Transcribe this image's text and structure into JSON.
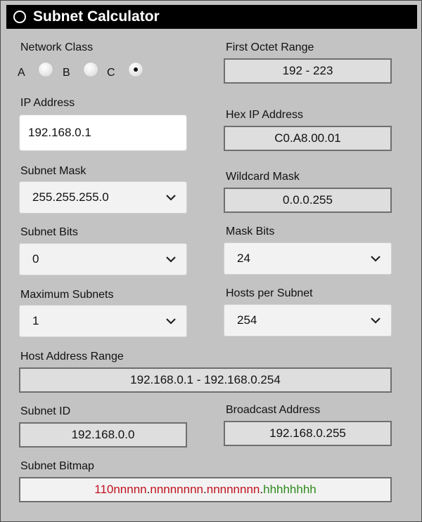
{
  "title": "Subnet Calculator",
  "network_class": {
    "label": "Network Class",
    "options": [
      {
        "letter": "A",
        "selected": false
      },
      {
        "letter": "B",
        "selected": false
      },
      {
        "letter": "C",
        "selected": true
      }
    ]
  },
  "first_octet_range": {
    "label": "First Octet Range",
    "value": "192 - 223"
  },
  "ip_address": {
    "label": "IP Address",
    "value": "192.168.0.1"
  },
  "hex_ip_address": {
    "label": "Hex IP Address",
    "value": "C0.A8.00.01"
  },
  "subnet_mask": {
    "label": "Subnet Mask",
    "value": "255.255.255.0"
  },
  "wildcard_mask": {
    "label": "Wildcard Mask",
    "value": "0.0.0.255"
  },
  "subnet_bits": {
    "label": "Subnet Bits",
    "value": "0"
  },
  "mask_bits": {
    "label": "Mask Bits",
    "value": "24"
  },
  "maximum_subnets": {
    "label": "Maximum Subnets",
    "value": "1"
  },
  "hosts_per_subnet": {
    "label": "Hosts per Subnet",
    "value": "254"
  },
  "host_address_range": {
    "label": "Host Address Range",
    "value": "192.168.0.1 - 192.168.0.254"
  },
  "subnet_id": {
    "label": "Subnet ID",
    "value": "192.168.0.0"
  },
  "broadcast_address": {
    "label": "Broadcast Address",
    "value": "192.168.0.255"
  },
  "subnet_bitmap": {
    "label": "Subnet Bitmap",
    "segments": [
      {
        "text": "110nnnnn",
        "kind": "net"
      },
      {
        "text": ".",
        "kind": "dot"
      },
      {
        "text": "nnnnnnnn",
        "kind": "net"
      },
      {
        "text": ".",
        "kind": "dot"
      },
      {
        "text": "nnnnnnnn",
        "kind": "net"
      },
      {
        "text": ".",
        "kind": "dot"
      },
      {
        "text": "hhhhhhhh",
        "kind": "host"
      }
    ]
  },
  "colors": {
    "network_bits": "#c1121f",
    "host_bits": "#2e8b1e",
    "titlebar": "#000000"
  }
}
